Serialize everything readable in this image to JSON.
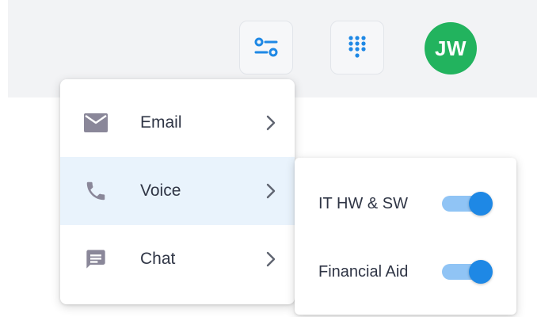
{
  "header": {
    "filters_button": {
      "icon": "filter-sliders-icon"
    },
    "dialpad_button": {
      "icon": "dialpad-icon"
    },
    "avatar": {
      "initials": "JW",
      "color": "#22b35e"
    }
  },
  "channel_menu": {
    "items": [
      {
        "label": "Email",
        "icon": "mail-icon",
        "has_submenu": true
      },
      {
        "label": "Voice",
        "icon": "phone-icon",
        "has_submenu": true,
        "highlighted": true
      },
      {
        "label": "Chat",
        "icon": "chat-icon",
        "has_submenu": true
      }
    ]
  },
  "voice_submenu": {
    "items": [
      {
        "label": "IT HW & SW",
        "enabled": true
      },
      {
        "label": "Financial Aid",
        "enabled": true
      }
    ]
  },
  "colors": {
    "accent": "#1e88e5",
    "accent_light": "#90c4f5",
    "icon_gray": "#8a8799",
    "highlight_bg": "#e9f3fc",
    "header_bg": "#f2f3f5"
  }
}
